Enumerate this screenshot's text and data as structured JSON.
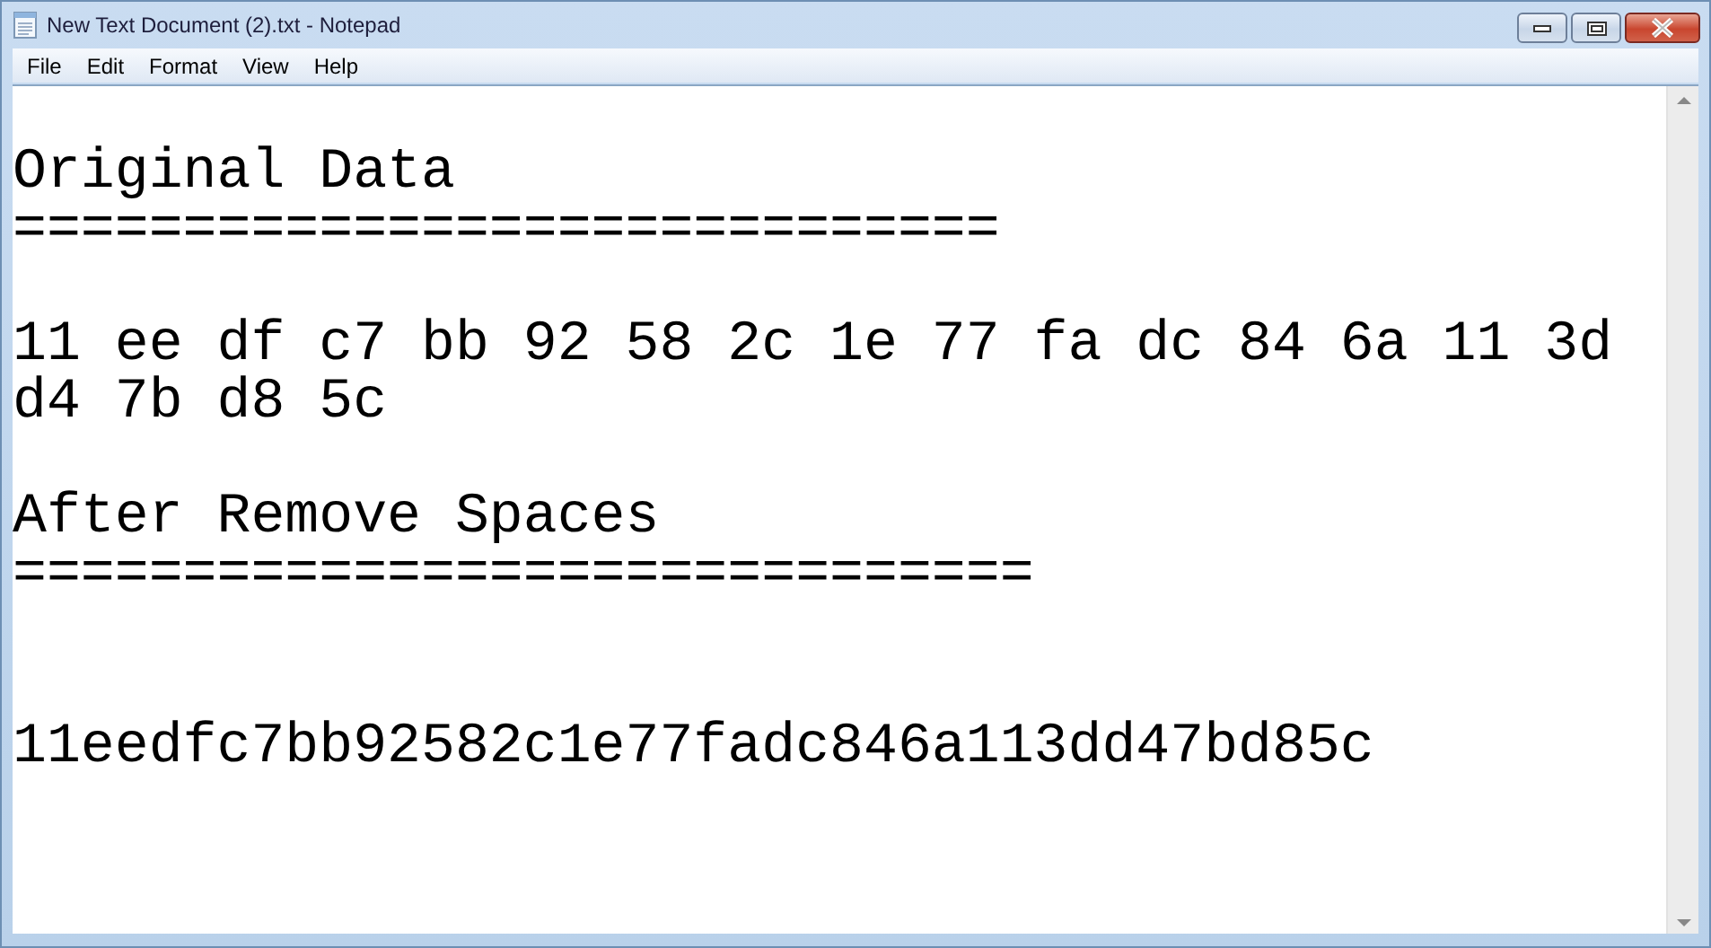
{
  "window": {
    "title": "New Text Document (2).txt - Notepad"
  },
  "menu": [
    "File",
    "Edit",
    "Format",
    "View",
    "Help"
  ],
  "document": {
    "lines": [
      {
        "kind": "blank"
      },
      {
        "kind": "text",
        "text": "Original Data"
      },
      {
        "kind": "text",
        "text": "============================="
      },
      {
        "kind": "blank"
      },
      {
        "kind": "text",
        "text": "11 ee df c7 bb 92 58 2c 1e 77 fa dc 84 6a 11 3d d4 7b d8 5c"
      },
      {
        "kind": "blank"
      },
      {
        "kind": "text",
        "text": "After Remove Spaces"
      },
      {
        "kind": "text",
        "text": "=============================="
      },
      {
        "kind": "blank"
      },
      {
        "kind": "blank"
      },
      {
        "kind": "text",
        "text": "11eedfc7bb92582c1e77fadc846a113dd47bd85c"
      }
    ]
  }
}
